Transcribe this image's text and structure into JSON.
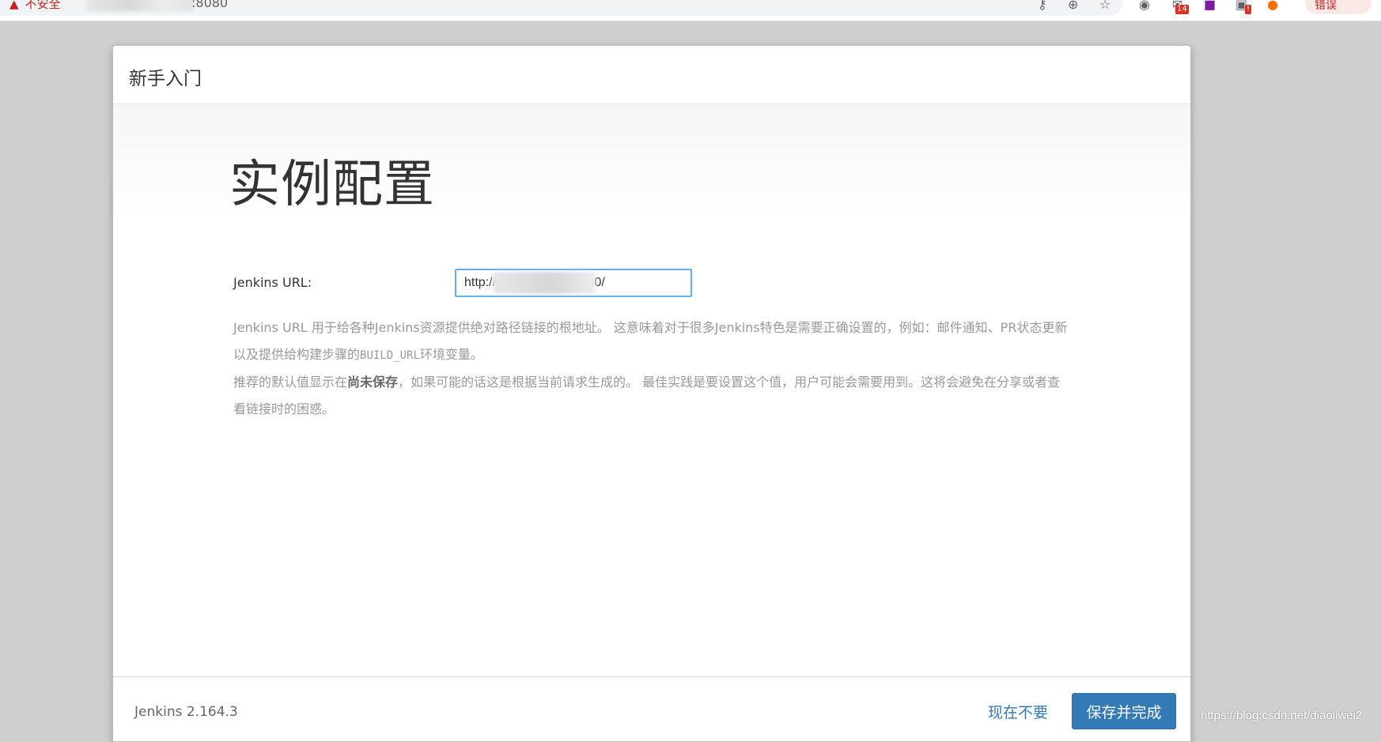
{
  "browser": {
    "security_label": "不安全",
    "url_suffix": ":8080",
    "extension_badge_count": "14",
    "extension_badge_alert": "!",
    "error_label": "错误"
  },
  "dialog": {
    "title": "新手入门",
    "heading": "实例配置",
    "form": {
      "url_label": "Jenkins URL:",
      "url_value": "http://.                    :8080/"
    },
    "help": {
      "line1_part1": "Jenkins URL 用于给各种Jenkins资源提供绝对路径链接的根地址。 这意味着对于很多Jenkins特色是需要正确设置的，例如：邮件通知、PR状态更新以及提供给构建步骤的",
      "build_url_code": "BUILD_URL",
      "line1_part2": "环境变量。",
      "line2_part1": "推荐的默认值显示在",
      "line2_bold": "尚未保存",
      "line2_part2": "，如果可能的话这是根据当前请求生成的。 最佳实践是要设置这个值，用户可能会需要用到。这将会避免在分享或者查看链接时的困惑。"
    },
    "footer": {
      "version": "Jenkins 2.164.3",
      "skip_label": "现在不要",
      "save_label": "保存并完成"
    }
  },
  "watermark": "https://blog.csdn.net/diaoliwei2",
  "colors": {
    "primary": "#337ab7",
    "input_focus": "#66afe9",
    "help_text": "#999999",
    "insecure": "#c5221f"
  }
}
